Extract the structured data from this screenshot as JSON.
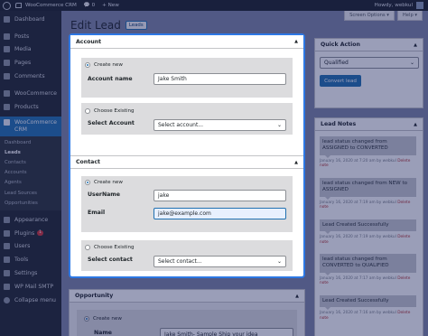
{
  "adminbar": {
    "site_name": "WooCommerce CRM",
    "comments_count": "0",
    "new_label": "+ New",
    "howdy": "Howdy, webkul"
  },
  "sidebar": {
    "items": [
      {
        "label": "Dashboard",
        "icon": "dashboard-icon"
      },
      {
        "label": "Posts",
        "icon": "pin-icon"
      },
      {
        "label": "Media",
        "icon": "media-icon"
      },
      {
        "label": "Pages",
        "icon": "page-icon"
      },
      {
        "label": "Comments",
        "icon": "comment-icon"
      },
      {
        "label": "WooCommerce",
        "icon": "woocommerce-icon"
      },
      {
        "label": "Products",
        "icon": "product-icon"
      }
    ],
    "active": {
      "label_line1": "WooCommerce",
      "label_line2": "CRM",
      "icon": "crm-icon"
    },
    "submenu": [
      "Dashboard",
      "Leads",
      "Contacts",
      "Accounts",
      "Agents",
      "Lead Sources",
      "Opportunities"
    ],
    "items_after": [
      {
        "label": "Appearance",
        "icon": "brush-icon"
      },
      {
        "label": "Plugins",
        "icon": "plugin-icon",
        "badge": "1"
      },
      {
        "label": "Users",
        "icon": "users-icon"
      },
      {
        "label": "Tools",
        "icon": "tools-icon"
      },
      {
        "label": "Settings",
        "icon": "settings-icon"
      },
      {
        "label": "WP Mail SMTP",
        "icon": "mail-icon"
      },
      {
        "label": "Collapse menu",
        "icon": "collapse-icon"
      }
    ]
  },
  "header": {
    "title": "Edit Lead",
    "title_button": "Leads",
    "screen_options": "Screen Options ▾",
    "help": "Help ▾"
  },
  "account": {
    "title": "Account",
    "create_new": "Create new",
    "account_name_label": "Account name",
    "account_name_value": "Jake Smith",
    "choose_existing": "Choose Existing",
    "select_account_label": "Select Account",
    "select_account_value": "Select account..."
  },
  "contact": {
    "title": "Contact",
    "create_new": "Create new",
    "username_label": "UserName",
    "username_value": "jake",
    "email_label": "Email",
    "email_value": "jake@example.com",
    "choose_existing": "Choose Existing",
    "select_contact_label": "Select contact",
    "select_contact_value": "Select contact..."
  },
  "opportunity": {
    "title": "Opportunity",
    "create_new": "Create new",
    "name_label": "Name",
    "name_value": "Jake Smith- Sample Ship your idea"
  },
  "quick_action": {
    "title": "Quick Action",
    "status_value": "Qualified",
    "convert_button": "Convert lead"
  },
  "lead_notes": {
    "title": "Lead Notes",
    "notes": [
      {
        "text": "lead status changed from ASSIGNED to CONVERTED",
        "meta": "January 16, 2020 at 7:20 am by webkul",
        "delete": "Delete note"
      },
      {
        "text": "lead status changed from NEW to ASSIGNED",
        "meta": "January 16, 2020 at 7:19 am by webkul",
        "delete": "Delete note"
      },
      {
        "text": "Lead Created Successfully",
        "meta": "January 16, 2020 at 7:19 am by webkul",
        "delete": "Delete note"
      },
      {
        "text": "lead status changed from CONVERTED to QUALIFIED",
        "meta": "January 16, 2020 at 7:17 am by webkul",
        "delete": "Delete note"
      },
      {
        "text": "Lead Created Successfully",
        "meta": "January 16, 2020 at 7:16 am by webkul",
        "delete": "Delete note"
      }
    ]
  },
  "colors": {
    "accent": "#2271b1",
    "highlight_border": "#2d78e4",
    "overlay": "#141e5a"
  }
}
